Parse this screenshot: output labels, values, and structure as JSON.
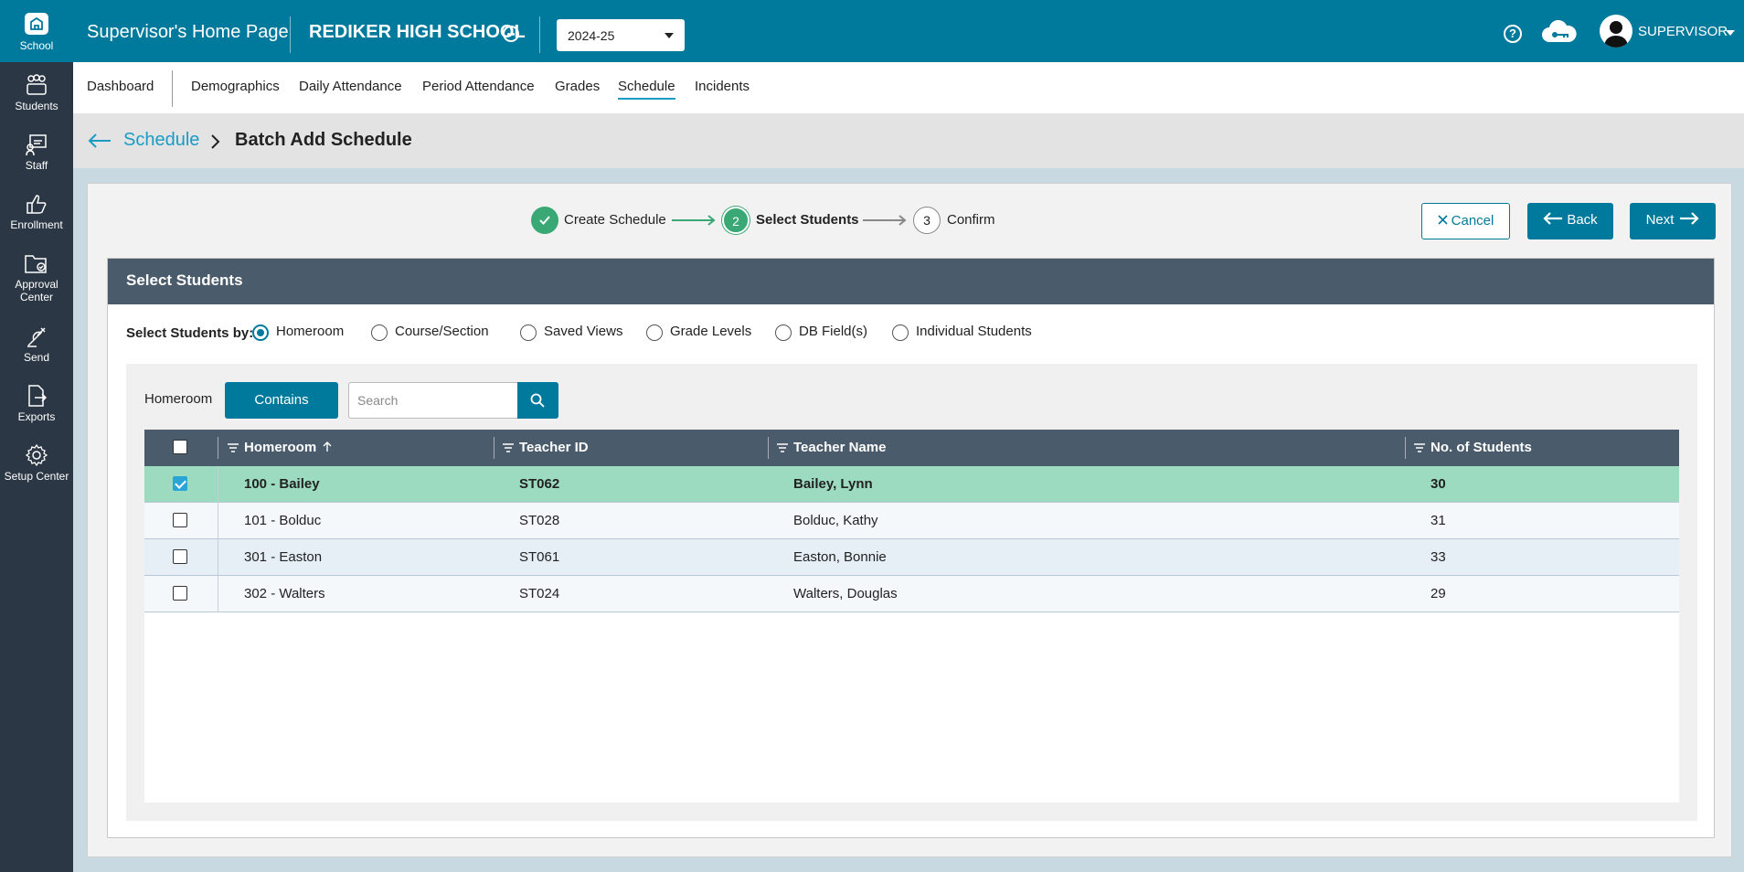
{
  "rail": [
    {
      "label": "School",
      "icon": "school-icon"
    },
    {
      "label": "Students",
      "icon": "students-icon"
    },
    {
      "label": "Staff",
      "icon": "staff-icon"
    },
    {
      "label": "Enrollment",
      "icon": "enrollment-icon"
    },
    {
      "label": "Approval Center",
      "icon": "approval-center-icon"
    },
    {
      "label": "Send",
      "icon": "send-icon"
    },
    {
      "label": "Exports",
      "icon": "exports-icon"
    },
    {
      "label": "Setup Center",
      "icon": "setup-center-icon"
    }
  ],
  "topbar": {
    "title": "Supervisor's Home Page",
    "school": "REDIKER HIGH SCHOOL",
    "year": "2024-25",
    "user": "SUPERVISOR"
  },
  "nav": [
    "Dashboard",
    "Demographics",
    "Daily Attendance",
    "Period Attendance",
    "Grades",
    "Schedule",
    "Incidents"
  ],
  "breadcrumb": {
    "parent": "Schedule",
    "current": "Batch Add Schedule"
  },
  "stepper": [
    {
      "num": "",
      "label": "Create Schedule",
      "state": "done"
    },
    {
      "num": "2",
      "label": "Select Students",
      "state": "current"
    },
    {
      "num": "3",
      "label": "Confirm",
      "state": "todo"
    }
  ],
  "actions": {
    "cancel": "Cancel",
    "back": "Back",
    "next": "Next"
  },
  "card": {
    "title": "Select Students",
    "select_by_label": "Select Students by:",
    "options": [
      "Homeroom",
      "Course/Section",
      "Saved Views",
      "Grade Levels",
      "DB Field(s)",
      "Individual Students"
    ],
    "selected_option": "Homeroom"
  },
  "filter": {
    "label": "Homeroom",
    "mode": "Contains",
    "search_placeholder": "Search"
  },
  "table": {
    "columns": [
      "Homeroom",
      "Teacher ID",
      "Teacher Name",
      "No. of Students"
    ],
    "rows": [
      {
        "homeroom": "100 - Bailey",
        "teacher_id": "ST062",
        "teacher_name": "Bailey, Lynn",
        "students": "30",
        "checked": true
      },
      {
        "homeroom": "101 - Bolduc",
        "teacher_id": "ST028",
        "teacher_name": "Bolduc, Kathy",
        "students": "31",
        "checked": false
      },
      {
        "homeroom": "301 - Easton",
        "teacher_id": "ST061",
        "teacher_name": "Easton, Bonnie",
        "students": "33",
        "checked": false
      },
      {
        "homeroom": "302 - Walters",
        "teacher_id": "ST024",
        "teacher_name": "Walters, Douglas",
        "students": "29",
        "checked": false
      }
    ]
  },
  "colors": {
    "primary": "#007a9c",
    "rail": "#2b3744",
    "header_dark": "#4a5b6c",
    "selected_row": "#9ddbc1",
    "step_done": "#3aa874"
  }
}
